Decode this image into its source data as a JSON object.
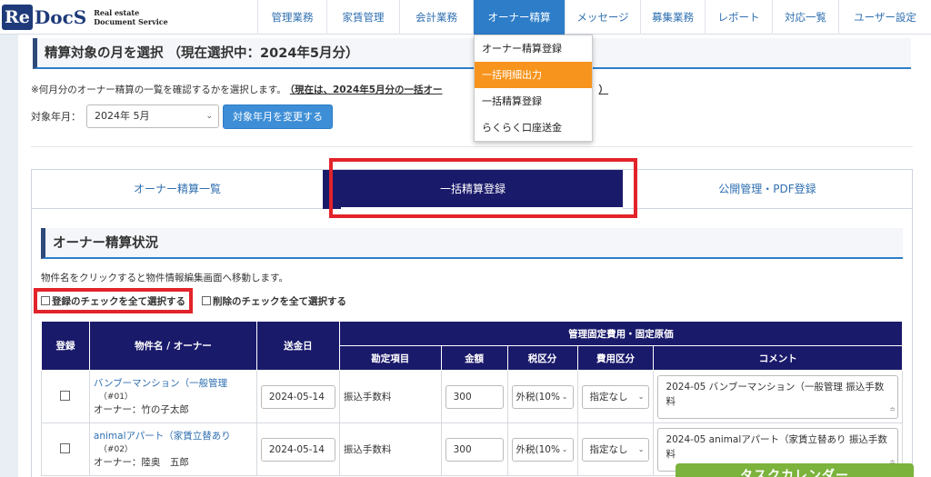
{
  "header": {
    "logo_re": "Re",
    "logo_docs": "DocS",
    "logo_sub_line1": "Real estate",
    "logo_sub_line2": "Document Service",
    "nav": [
      "管理業務",
      "家賃管理",
      "会計業務",
      "オーナー精算",
      "メッセージ",
      "募集業務",
      "レポート",
      "対応一覧",
      "ユーザー設定"
    ],
    "active_nav": "オーナー精算"
  },
  "dropdown": {
    "items": [
      "オーナー精算登録",
      "一括明細出力",
      "一括精算登録",
      "らくらく口座送金"
    ],
    "highlighted": "一括明細出力"
  },
  "month_section": {
    "heading": "精算対象の月を選択 （現在選択中：2024年5月分）",
    "note": "※何月分のオーナー精算の一覧を確認するかを選択します。",
    "note_emphasis": "（現在は、2024年5月分の一括オー",
    "note_emphasis_tail": "）",
    "month_label": "対象年月：",
    "month_value": "2024年 5月",
    "change_button": "対象年月を変更する"
  },
  "tabs": [
    "オーナー精算一覧",
    "一括精算登録",
    "公開管理・PDF登録"
  ],
  "active_tab": "一括精算登録",
  "status_section": {
    "heading": "オーナー精算状況",
    "hint": "物件名をクリックすると物件情報編集画面へ移動します。",
    "check_all_register": "登録のチェックを全て選択する",
    "check_all_delete": "削除のチェックを全て選択する"
  },
  "table": {
    "headers": {
      "register": "登録",
      "property_owner": "物件名 / オーナー",
      "send_date": "送金日",
      "group": "管理固定費用・固定原価",
      "account": "勘定項目",
      "amount": "金額",
      "tax": "税区分",
      "cost_type": "費用区分",
      "comment": "コメント"
    },
    "rows": [
      {
        "property": "バンブーマンション（一般管理",
        "code": "（#01）",
        "owner": "オーナー：竹の子太郎",
        "send_date": "2024-05-14",
        "account": "振込手数料",
        "amount": "300",
        "tax": "外税(10%",
        "cost_type": "指定なし",
        "comment": "2024-05 バンブーマンション（一般管理 振込手数料"
      },
      {
        "property": "animalアパート（家賃立替あり",
        "code": "（#02）",
        "owner": "オーナー：陸奥　五郎",
        "send_date": "2024-05-14",
        "account": "振込手数料",
        "amount": "300",
        "tax": "外税(10%",
        "cost_type": "指定なし",
        "comment": "2024-05 animalアパート（家賃立替あり 振込手数料"
      }
    ]
  },
  "task_calendar": "タスクカレンダー",
  "colors": {
    "brand_navy": "#1a1a6b",
    "nav_active": "#2e7dc8",
    "dropdown_highlight": "#f7941d",
    "annotation_red": "#e2232a",
    "task_green": "#7bb33c"
  }
}
